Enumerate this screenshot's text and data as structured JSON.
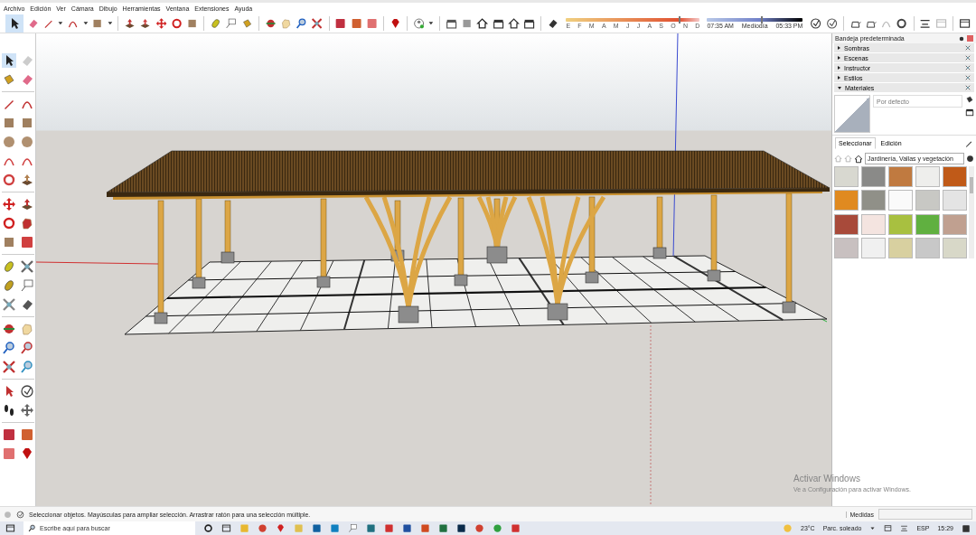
{
  "menu": [
    "Archivo",
    "Edición",
    "Ver",
    "Cámara",
    "Dibujo",
    "Herramientas",
    "Ventana",
    "Extensiones",
    "Ayuda"
  ],
  "shadow_settings": {
    "months": [
      "E",
      "F",
      "M",
      "A",
      "M",
      "J",
      "J",
      "A",
      "S",
      "O",
      "N",
      "D"
    ],
    "date_slider": {
      "level": 0.84
    },
    "time_slider": {
      "level": 0.56
    },
    "time_start": "07:35 AM",
    "time_middle": "Mediodía",
    "time_end": "05:33 PM"
  },
  "tray": {
    "title": "Bandeja predeterminada",
    "panels": [
      {
        "label": "Sombras",
        "expanded": false
      },
      {
        "label": "Escenas",
        "expanded": false
      },
      {
        "label": "Instructor",
        "expanded": false
      },
      {
        "label": "Estilos",
        "expanded": false
      },
      {
        "label": "Materiales",
        "expanded": true
      }
    ]
  },
  "materials": {
    "name": "Por defecto",
    "tabs": [
      {
        "label": "Seleccionar",
        "selected": true
      },
      {
        "label": "Edición",
        "selected": false
      }
    ],
    "collection": "Jardinería, Vallas y vegetación",
    "swatches": [
      {
        "color": "#d8d8d0"
      },
      {
        "color": "#8a8a88"
      },
      {
        "color": "#c07a40"
      },
      {
        "color": "#eeeeec"
      },
      {
        "color": "#c05a18"
      },
      {
        "color": "#e08a20"
      },
      {
        "color": "#909088"
      },
      {
        "color": "#fafafa"
      },
      {
        "color": "#c8c8c4"
      },
      {
        "color": "#e4e4e4"
      },
      {
        "color": "#a84a3a"
      },
      {
        "color": "#f4e4e0"
      },
      {
        "color": "#a8c040"
      },
      {
        "color": "#60b040"
      },
      {
        "color": "#c0a090"
      },
      {
        "color": "#c8c0c0"
      },
      {
        "color": "#f0f0f0"
      },
      {
        "color": "#d8d0a0"
      },
      {
        "color": "#c8c8c8"
      },
      {
        "color": "#d8d8c8"
      }
    ]
  },
  "status_bar": {
    "message": "Seleccionar objetos. Mayúsculas para ampliar selección. Arrastrar ratón para una selección múltiple.",
    "measurements_label": "Medidas"
  },
  "activation_notice": {
    "title": "Activar Windows",
    "text": "Ve a Configuración para activar Windows."
  },
  "taskbar": {
    "search_placeholder": "Escribe aquí para buscar",
    "temperature": "23°C",
    "weather": "Parc. soleado",
    "language": "ESP",
    "time": "15:29"
  }
}
